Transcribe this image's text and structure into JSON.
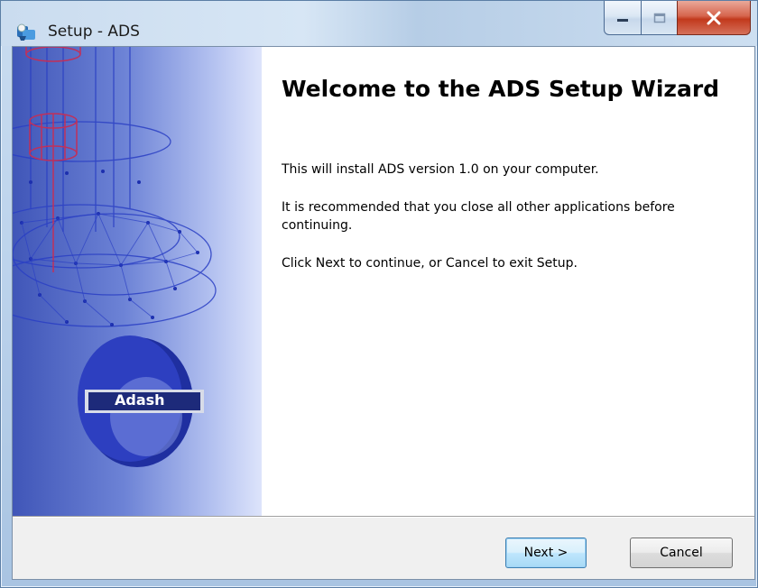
{
  "window": {
    "title": "Setup - ADS"
  },
  "title_icon": "setup-app-icon",
  "caption_buttons": {
    "minimize_icon": "minimize-icon",
    "maximize_icon": "maximize-icon",
    "close_icon": "close-icon",
    "close_color": "#c2391c"
  },
  "side_image": {
    "logo_text": "Adash",
    "colors": {
      "dark": "#4056b8",
      "light": "#dde4fb",
      "wire": "#3a47c8"
    }
  },
  "content": {
    "heading": "Welcome to the ADS Setup Wizard",
    "paragraph1": "This will install ADS version 1.0 on your computer.",
    "paragraph2": "It is recommended that you close all other applications before continuing.",
    "paragraph3": "Click Next to continue, or Cancel to exit Setup."
  },
  "buttons": {
    "next_label": "Next >",
    "cancel_label": "Cancel"
  }
}
